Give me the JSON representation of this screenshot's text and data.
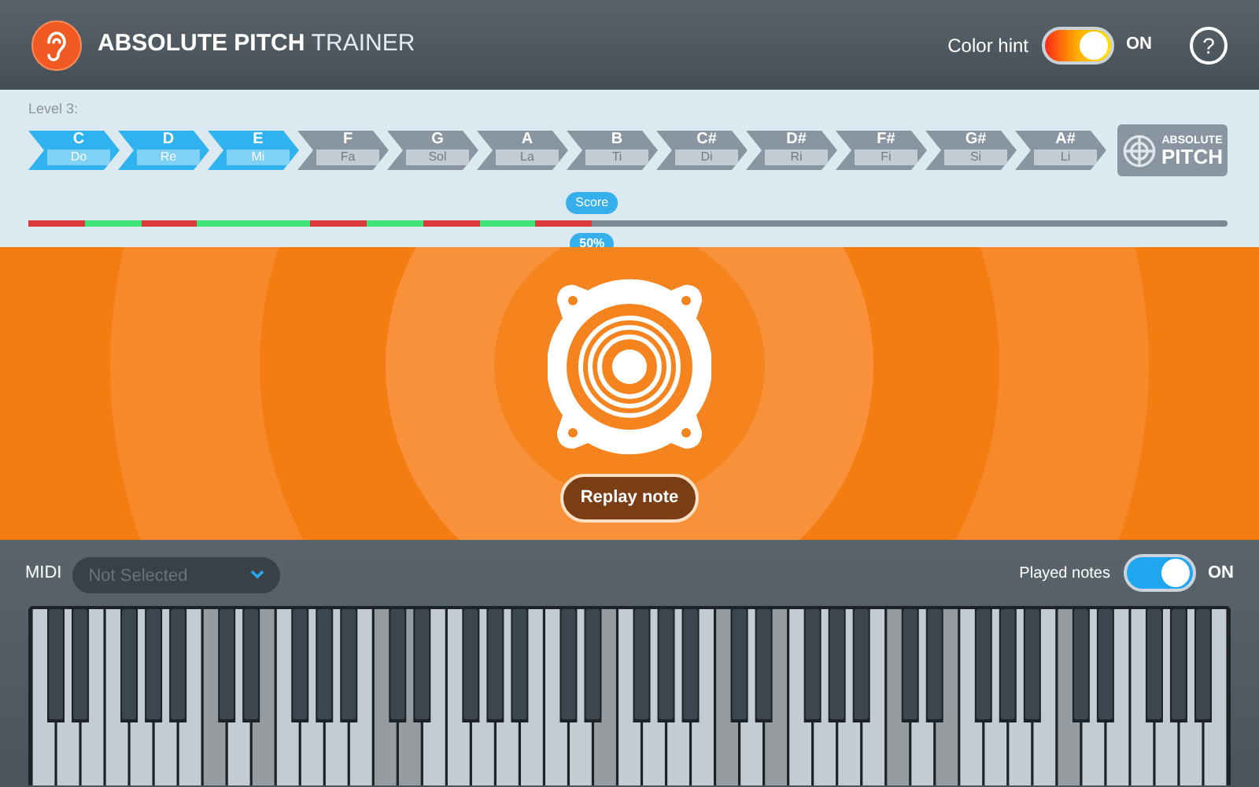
{
  "header": {
    "title_bold": "ABSOLUTE PITCH",
    "title_light": "TRAINER",
    "color_hint": {
      "label": "Color hint",
      "on": true,
      "state_text": "ON"
    },
    "help": "?"
  },
  "level": {
    "label": "Level 3:"
  },
  "notes": [
    {
      "name": "C",
      "solfege": "Do",
      "selected": true
    },
    {
      "name": "D",
      "solfege": "Re",
      "selected": true
    },
    {
      "name": "E",
      "solfege": "Mi",
      "selected": true
    },
    {
      "name": "F",
      "solfege": "Fa",
      "selected": false
    },
    {
      "name": "G",
      "solfege": "Sol",
      "selected": false
    },
    {
      "name": "A",
      "solfege": "La",
      "selected": false
    },
    {
      "name": "B",
      "solfege": "Ti",
      "selected": false
    },
    {
      "name": "C#",
      "solfege": "Di",
      "selected": false
    },
    {
      "name": "D#",
      "solfege": "Ri",
      "selected": false
    },
    {
      "name": "F#",
      "solfege": "Fi",
      "selected": false
    },
    {
      "name": "G#",
      "solfege": "Si",
      "selected": false
    },
    {
      "name": "A#",
      "solfege": "Li",
      "selected": false
    }
  ],
  "badge": {
    "top": "ABSOLUTE",
    "bottom": "PITCH"
  },
  "score": {
    "label": "Score",
    "level": 0.47,
    "reading": "50%",
    "results": [
      {
        "correct": false
      },
      {
        "correct": true
      },
      {
        "correct": false
      },
      {
        "correct": true
      },
      {
        "correct": true
      },
      {
        "correct": false
      },
      {
        "correct": true
      },
      {
        "correct": false
      },
      {
        "correct": true
      },
      {
        "correct": false
      }
    ]
  },
  "replay_button": "Replay note",
  "midi": {
    "label": "MIDI",
    "placeholder": "Not Selected"
  },
  "played_notes": {
    "label": "Played notes",
    "on": true,
    "state_text": "ON"
  },
  "white_keys": [
    {
      "played": false
    },
    {
      "played": false
    },
    {
      "played": false
    },
    {
      "played": false
    },
    {
      "played": false
    },
    {
      "played": false
    },
    {
      "played": false
    },
    {
      "played": true
    },
    {
      "played": false
    },
    {
      "played": true
    },
    {
      "played": false
    },
    {
      "played": false
    },
    {
      "played": false
    },
    {
      "played": false
    },
    {
      "played": true
    },
    {
      "played": true
    },
    {
      "played": false
    },
    {
      "played": false
    },
    {
      "played": false
    },
    {
      "played": false
    },
    {
      "played": false
    },
    {
      "played": false
    },
    {
      "played": false
    },
    {
      "played": true
    },
    {
      "played": false
    },
    {
      "played": false
    },
    {
      "played": false
    },
    {
      "played": false
    },
    {
      "played": true
    },
    {
      "played": false
    },
    {
      "played": true
    },
    {
      "played": false
    },
    {
      "played": false
    },
    {
      "played": false
    },
    {
      "played": false
    },
    {
      "played": true
    },
    {
      "played": false
    },
    {
      "played": true
    },
    {
      "played": false
    },
    {
      "played": false
    },
    {
      "played": false
    },
    {
      "played": false
    },
    {
      "played": true
    },
    {
      "played": false
    },
    {
      "played": false
    },
    {
      "played": false
    },
    {
      "played": false
    },
    {
      "played": false
    },
    {
      "played": false
    }
  ]
}
